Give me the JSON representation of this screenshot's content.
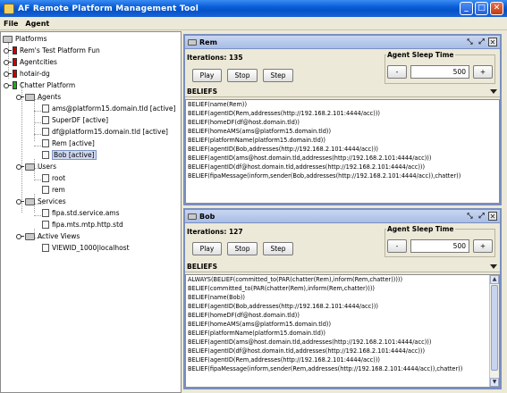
{
  "window": {
    "title": "AF Remote Platform Management Tool"
  },
  "menu": {
    "file": "File",
    "agent": "Agent"
  },
  "tree": {
    "root": "Platforms",
    "platforms": [
      "Rem's Test Platform Fun",
      "Agentcities",
      "hotair-dg",
      "Chatter Platform"
    ],
    "platform_colors": [
      "#cc0000",
      "#cc0000",
      "#cc0000",
      "#22aa22"
    ],
    "agents_label": "Agents",
    "agents": [
      "ams@platform15.domain.tld [active]",
      "SuperDF [active]",
      "df@platform15.domain.tld [active]",
      "Rem [active]",
      "Bob [active]"
    ],
    "users_label": "Users",
    "users": [
      "root",
      "rem"
    ],
    "services_label": "Services",
    "services": [
      "fipa.std.service.ams",
      "fipa.mts.mtp.http.std"
    ],
    "views_label": "Active Views",
    "views": [
      "VIEWID_1000|localhost"
    ]
  },
  "rem": {
    "title": "Rem",
    "iterations": "Iterations: 135",
    "play": "Play",
    "stop": "Stop",
    "step": "Step",
    "sleep_label": "Agent Sleep Time",
    "sleep_minus": "-",
    "sleep_value": "500",
    "sleep_plus": "+",
    "beliefs_label": "BELIEFS",
    "beliefs": [
      "BELIEF(name(Rem))",
      "BELIEF(agentID(Rem,addresses(http://192.168.2.101:4444/acc)))",
      "BELIEF(homeDF(df@host.domain.tld))",
      "BELIEF(homeAMS(ams@platform15.domain.tld))",
      "BELIEF(platformName(platform15.domain.tld))",
      "BELIEF(agentID(Bob,addresses(http://192.168.2.101:4444/acc)))",
      "BELIEF(agentID(ams@host.domain.tld,addresses(http://192.168.2.101:4444/acc)))",
      "BELIEF(agentID(df@host.domain.tld,addresses(http://192.168.2.101:4444/acc)))",
      "BELIEF(fipaMessage(inform,sender(Bob,addresses(http://192.168.2.101:4444/acc)),chatter))"
    ]
  },
  "bob": {
    "title": "Bob",
    "iterations": "Iterations: 127",
    "play": "Play",
    "stop": "Stop",
    "step": "Step",
    "sleep_label": "Agent Sleep Time",
    "sleep_minus": "-",
    "sleep_value": "500",
    "sleep_plus": "+",
    "beliefs_label": "BELIEFS",
    "beliefs": [
      "ALWAYS(BELIEF(committed_to(PAR(chatter(Rem),inform(Rem,chatter)))))",
      "BELIEF(committed_to(PAR(chatter(Rem),inform(Rem,chatter))))",
      "BELIEF(name(Bob))",
      "BELIEF(agentID(Bob,addresses(http://192.168.2.101:4444/acc)))",
      "BELIEF(homeDF(df@host.domain.tld))",
      "BELIEF(homeAMS(ams@platform15.domain.tld))",
      "BELIEF(platformName(platform15.domain.tld))",
      "BELIEF(agentID(ams@host.domain.tld,addresses(http://192.168.2.101:4444/acc)))",
      "BELIEF(agentID(df@host.domain.tld,addresses(http://192.168.2.101:4444/acc)))",
      "BELIEF(agentID(Rem,addresses(http://192.168.2.101:4444/acc)))",
      "BELIEF(fipaMessage(inform,sender(Rem,addresses(http://192.168.2.101:4444/acc)),chatter))"
    ]
  }
}
